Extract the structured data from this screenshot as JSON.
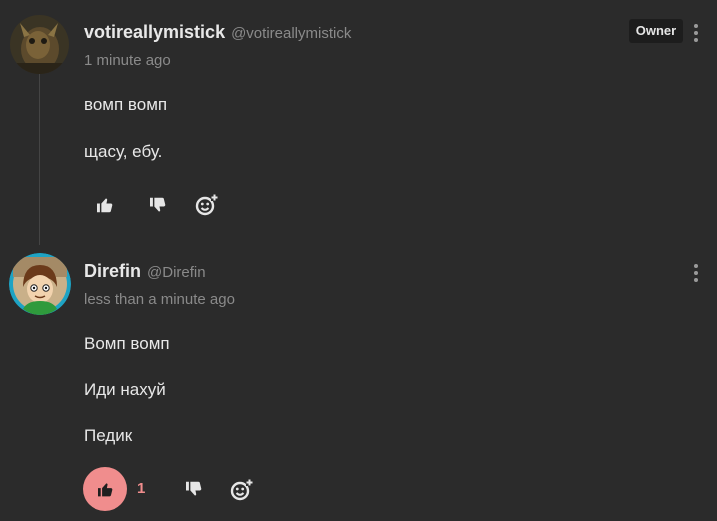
{
  "comments": [
    {
      "author": "votireallymistick",
      "handle": "@votireallymistick",
      "time": "1 minute ago",
      "badge": "Owner",
      "lines": [
        "вомп вомп",
        "щасу, ебу."
      ],
      "like_count": ""
    },
    {
      "author": "Direfin",
      "handle": "@Direfin",
      "time": "less than a minute ago",
      "badge": "",
      "lines": [
        "Вомп вомп",
        "Иди нахуй",
        "Педик"
      ],
      "like_count": "1"
    }
  ],
  "icons": {
    "like": "thumbs-up-icon",
    "dislike": "thumbs-down-icon",
    "react": "add-reaction-icon",
    "menu": "more-vertical-icon"
  },
  "colors": {
    "background": "#2b2b2b",
    "text": "#e8e8e8",
    "muted": "#8a8a8a",
    "accent_like": "#f08d8d",
    "badge_bg": "#1d1d1d"
  }
}
